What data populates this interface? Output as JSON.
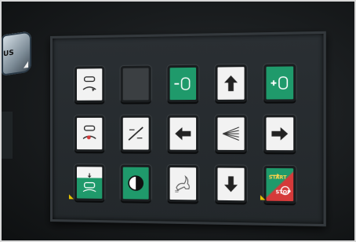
{
  "left_control": {
    "label": "US"
  },
  "buttons": [
    {
      "icon": "cycle-arrow-icon"
    },
    {
      "icon": "blank"
    },
    {
      "icon": "minus-tank-icon",
      "label": "-"
    },
    {
      "icon": "arrow-up-icon"
    },
    {
      "icon": "plus-tank-icon",
      "label": "+"
    },
    {
      "icon": "cycle-record-icon"
    },
    {
      "icon": "diagonal-lines-icon"
    },
    {
      "icon": "arrow-left-icon"
    },
    {
      "icon": "spray-lines-icon"
    },
    {
      "icon": "arrow-right-icon"
    },
    {
      "icon": "sensor-tank-icon"
    },
    {
      "icon": "half-circle-icon"
    },
    {
      "icon": "hare-icon"
    },
    {
      "icon": "arrow-down-icon"
    },
    {
      "icon": "start-stop-icon",
      "start_label": "START",
      "stop_label": "STOP"
    }
  ],
  "colors": {
    "green": "#1f9a6b",
    "red": "#d53a3a",
    "indicator": "#e6c400"
  }
}
